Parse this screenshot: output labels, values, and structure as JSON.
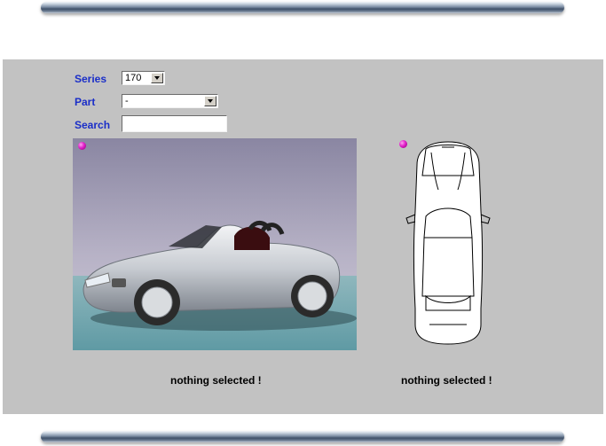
{
  "form": {
    "series": {
      "label": "Series",
      "value": "170"
    },
    "part": {
      "label": "Part",
      "value": "-"
    },
    "search": {
      "label": "Search",
      "value": ""
    }
  },
  "status": {
    "photo": "nothing selected !",
    "plan": "nothing selected !"
  },
  "icons": {
    "photo_pin": "magenta-pin-icon",
    "plan_pin": "magenta-pin-icon"
  },
  "colors": {
    "label": "#1a2ec8",
    "panel": "#c2c2c2",
    "pin": "#e020c8"
  }
}
